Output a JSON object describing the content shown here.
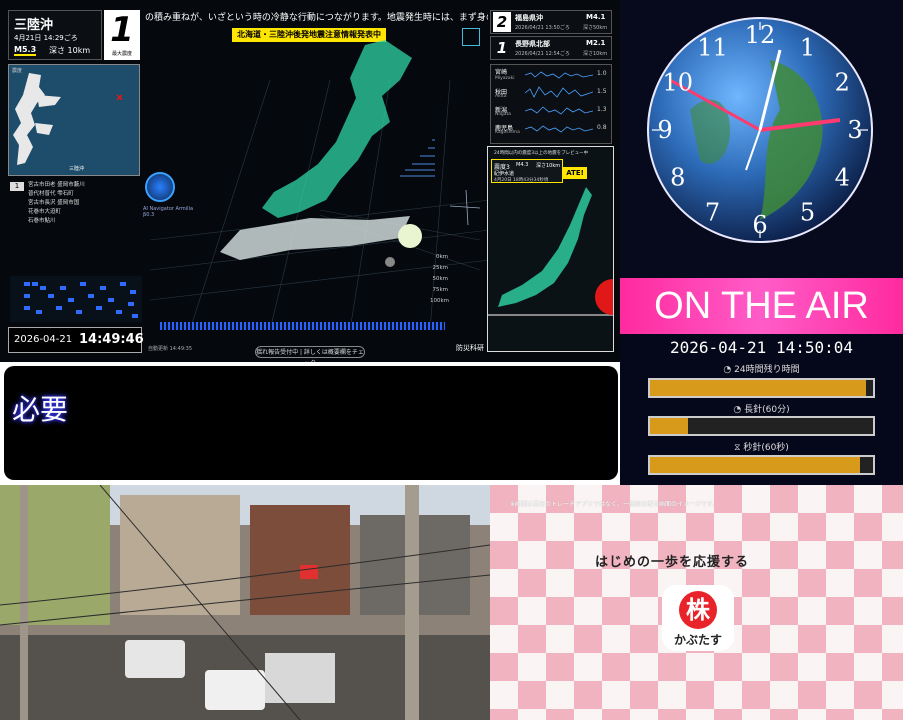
{
  "quake": {
    "region": "三陸沖",
    "datetime": "4月21日 14:29ごろ",
    "magnitude": "M5.3",
    "depth": "深さ 10km",
    "max_intensity": "1",
    "max_intensity_label": "最大震度",
    "minimap_label": "三陸沖",
    "minimap_corner": "震度",
    "intensity_group_num": "1",
    "places": [
      "宮古市田老 盛岡市藪川",
      "普代村普代 雫石町",
      "宮古市長沢 盛岡市国",
      "花巻市大迫町",
      "石巻市鮎川"
    ],
    "ticker": "の積み重ねが、いざという時の冷静な行動につながります。地震発生時には、まず身の安全を最優先に",
    "alert": "北海道・三陸沖後発地震注意情報発表中",
    "clock_date": "2026-04-21",
    "clock_time": "14:49:46",
    "navigator": "AI Navigator Armilla β0.3",
    "button": "揺れ報告受付中 | 詳しくは概要欄をチェック",
    "timestamp_small": "自動更新 14:49:35",
    "logo": "防災科研",
    "depth_scale": [
      "0km",
      "25km",
      "50km",
      "75km",
      "100km"
    ],
    "recent": [
      {
        "rank": "2",
        "place": "福島県沖",
        "mag": "M4.1",
        "time": "2026/04/21 13:50ごろ",
        "depth": "深さ50km"
      },
      {
        "rank": "1",
        "place": "長野県北部",
        "mag": "M2.1",
        "time": "2026/04/21 12:54ごろ",
        "depth": "深さ10km"
      }
    ],
    "stations": [
      {
        "jp": "宮崎",
        "en": "Miyazaki",
        "val": "1.0"
      },
      {
        "jp": "秋田",
        "en": "Akita",
        "val": "1.5"
      },
      {
        "jp": "新潟",
        "en": "Niigata",
        "val": "1.3"
      },
      {
        "jp": "鹿児島",
        "en": "Kagoshima",
        "val": "0.8"
      }
    ],
    "preview_title": "24時間以内の震度3以上の地震をプレビュー中",
    "preview_item": {
      "level": "震度3",
      "mag": "M4.3",
      "depth": "深さ10km",
      "place": "紀伊水道",
      "time": "4月20日 18時43分34秒頃"
    },
    "preview_badge": "ATE!",
    "colors": {
      "accent": "#ffe600",
      "land": "#2fd6a5"
    }
  },
  "clock": {
    "numerals": [
      "12",
      "1",
      "2",
      "3",
      "4",
      "5",
      "6",
      "7",
      "8",
      "9",
      "10",
      "11"
    ],
    "on_air": "ON THE AIR",
    "datetime": "2026-04-21 14:50:04",
    "bars": [
      {
        "label": "24時間残り時間",
        "icon": "clock-icon",
        "fraction": 0.97
      },
      {
        "label": "長針(60分)",
        "icon": "clock-icon",
        "fraction": 0.17
      },
      {
        "label": "秒針(60秒)",
        "icon": "hourglass-icon",
        "fraction": 0.94
      }
    ]
  },
  "text_panel": {
    "text": "必要"
  },
  "ad": {
    "top_text": "※画面は実在のトレードアプリではなく、一般的な取引画面のイメージです。",
    "tagline": "はじめの一歩を応援する",
    "logo_char": "株",
    "logo_name": "かぶたす"
  }
}
